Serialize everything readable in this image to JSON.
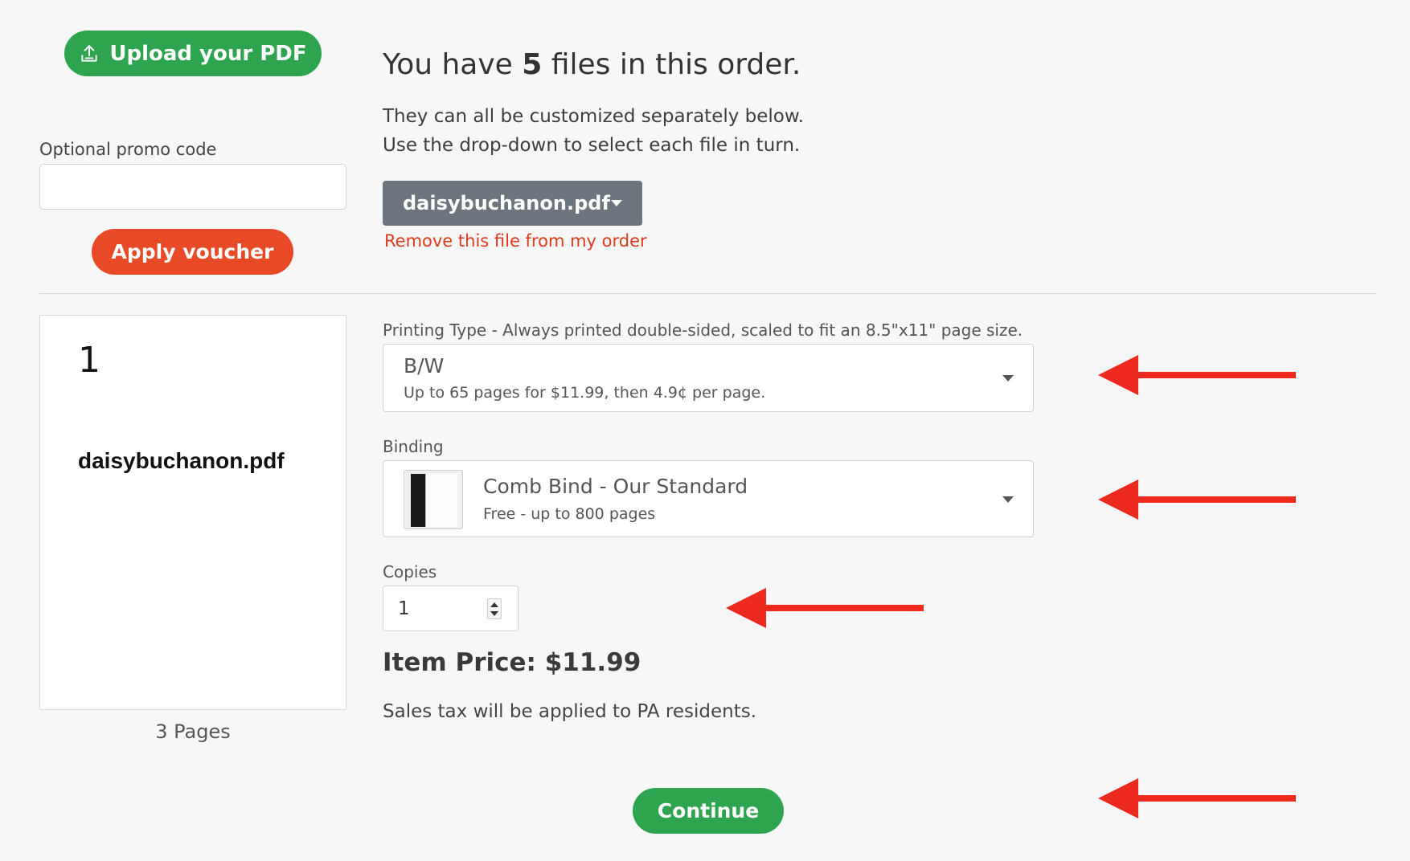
{
  "upload": {
    "label": "Upload your PDF",
    "icon": "upload-icon"
  },
  "promo": {
    "label": "Optional promo code",
    "value": "",
    "placeholder": ""
  },
  "voucher": {
    "label": "Apply voucher"
  },
  "files": {
    "heading_pre": "You have ",
    "count": "5",
    "heading_post": " files in this order.",
    "instruction_1": "They can all be customized separately below.",
    "instruction_2": "Use the drop-down to select each file in turn.",
    "selected_file": "daisybuchanon.pdf",
    "remove_link": "Remove this file from my order"
  },
  "preview": {
    "page_number": "1",
    "file_name": "daisybuchanon.pdf",
    "pages": "3 Pages"
  },
  "printing": {
    "label": "Printing Type - Always printed double-sided, scaled to fit an 8.5\"x11\" page size.",
    "selected_title": "B/W",
    "selected_sub": "Up to 65 pages for $11.99, then 4.9¢ per page."
  },
  "binding": {
    "label": "Binding",
    "selected_title": "Comb Bind - Our Standard",
    "selected_sub": "Free - up to 800 pages"
  },
  "copies": {
    "label": "Copies",
    "value": "1"
  },
  "price": {
    "label": "Item Price: $11.99"
  },
  "tax_note": "Sales tax will be applied to PA residents.",
  "continue": {
    "label": "Continue"
  },
  "colors": {
    "primary_green": "#2ea44f",
    "voucher_orange": "#e84a27",
    "dropdown_gray": "#6c757d",
    "link_red": "#e03a1e",
    "annotation_red": "#ee2a1e"
  }
}
